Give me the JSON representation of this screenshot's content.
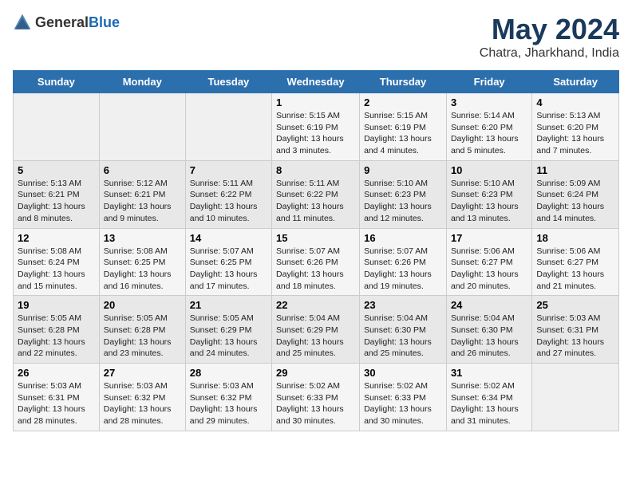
{
  "logo": {
    "text_general": "General",
    "text_blue": "Blue"
  },
  "header": {
    "main_title": "May 2024",
    "subtitle": "Chatra, Jharkhand, India"
  },
  "days_of_week": [
    "Sunday",
    "Monday",
    "Tuesday",
    "Wednesday",
    "Thursday",
    "Friday",
    "Saturday"
  ],
  "weeks": [
    {
      "days": [
        {
          "number": "",
          "info": ""
        },
        {
          "number": "",
          "info": ""
        },
        {
          "number": "",
          "info": ""
        },
        {
          "number": "1",
          "info": "Sunrise: 5:15 AM\nSunset: 6:19 PM\nDaylight: 13 hours and 3 minutes."
        },
        {
          "number": "2",
          "info": "Sunrise: 5:15 AM\nSunset: 6:19 PM\nDaylight: 13 hours and 4 minutes."
        },
        {
          "number": "3",
          "info": "Sunrise: 5:14 AM\nSunset: 6:20 PM\nDaylight: 13 hours and 5 minutes."
        },
        {
          "number": "4",
          "info": "Sunrise: 5:13 AM\nSunset: 6:20 PM\nDaylight: 13 hours and 7 minutes."
        }
      ]
    },
    {
      "days": [
        {
          "number": "5",
          "info": "Sunrise: 5:13 AM\nSunset: 6:21 PM\nDaylight: 13 hours and 8 minutes."
        },
        {
          "number": "6",
          "info": "Sunrise: 5:12 AM\nSunset: 6:21 PM\nDaylight: 13 hours and 9 minutes."
        },
        {
          "number": "7",
          "info": "Sunrise: 5:11 AM\nSunset: 6:22 PM\nDaylight: 13 hours and 10 minutes."
        },
        {
          "number": "8",
          "info": "Sunrise: 5:11 AM\nSunset: 6:22 PM\nDaylight: 13 hours and 11 minutes."
        },
        {
          "number": "9",
          "info": "Sunrise: 5:10 AM\nSunset: 6:23 PM\nDaylight: 13 hours and 12 minutes."
        },
        {
          "number": "10",
          "info": "Sunrise: 5:10 AM\nSunset: 6:23 PM\nDaylight: 13 hours and 13 minutes."
        },
        {
          "number": "11",
          "info": "Sunrise: 5:09 AM\nSunset: 6:24 PM\nDaylight: 13 hours and 14 minutes."
        }
      ]
    },
    {
      "days": [
        {
          "number": "12",
          "info": "Sunrise: 5:08 AM\nSunset: 6:24 PM\nDaylight: 13 hours and 15 minutes."
        },
        {
          "number": "13",
          "info": "Sunrise: 5:08 AM\nSunset: 6:25 PM\nDaylight: 13 hours and 16 minutes."
        },
        {
          "number": "14",
          "info": "Sunrise: 5:07 AM\nSunset: 6:25 PM\nDaylight: 13 hours and 17 minutes."
        },
        {
          "number": "15",
          "info": "Sunrise: 5:07 AM\nSunset: 6:26 PM\nDaylight: 13 hours and 18 minutes."
        },
        {
          "number": "16",
          "info": "Sunrise: 5:07 AM\nSunset: 6:26 PM\nDaylight: 13 hours and 19 minutes."
        },
        {
          "number": "17",
          "info": "Sunrise: 5:06 AM\nSunset: 6:27 PM\nDaylight: 13 hours and 20 minutes."
        },
        {
          "number": "18",
          "info": "Sunrise: 5:06 AM\nSunset: 6:27 PM\nDaylight: 13 hours and 21 minutes."
        }
      ]
    },
    {
      "days": [
        {
          "number": "19",
          "info": "Sunrise: 5:05 AM\nSunset: 6:28 PM\nDaylight: 13 hours and 22 minutes."
        },
        {
          "number": "20",
          "info": "Sunrise: 5:05 AM\nSunset: 6:28 PM\nDaylight: 13 hours and 23 minutes."
        },
        {
          "number": "21",
          "info": "Sunrise: 5:05 AM\nSunset: 6:29 PM\nDaylight: 13 hours and 24 minutes."
        },
        {
          "number": "22",
          "info": "Sunrise: 5:04 AM\nSunset: 6:29 PM\nDaylight: 13 hours and 25 minutes."
        },
        {
          "number": "23",
          "info": "Sunrise: 5:04 AM\nSunset: 6:30 PM\nDaylight: 13 hours and 25 minutes."
        },
        {
          "number": "24",
          "info": "Sunrise: 5:04 AM\nSunset: 6:30 PM\nDaylight: 13 hours and 26 minutes."
        },
        {
          "number": "25",
          "info": "Sunrise: 5:03 AM\nSunset: 6:31 PM\nDaylight: 13 hours and 27 minutes."
        }
      ]
    },
    {
      "days": [
        {
          "number": "26",
          "info": "Sunrise: 5:03 AM\nSunset: 6:31 PM\nDaylight: 13 hours and 28 minutes."
        },
        {
          "number": "27",
          "info": "Sunrise: 5:03 AM\nSunset: 6:32 PM\nDaylight: 13 hours and 28 minutes."
        },
        {
          "number": "28",
          "info": "Sunrise: 5:03 AM\nSunset: 6:32 PM\nDaylight: 13 hours and 29 minutes."
        },
        {
          "number": "29",
          "info": "Sunrise: 5:02 AM\nSunset: 6:33 PM\nDaylight: 13 hours and 30 minutes."
        },
        {
          "number": "30",
          "info": "Sunrise: 5:02 AM\nSunset: 6:33 PM\nDaylight: 13 hours and 30 minutes."
        },
        {
          "number": "31",
          "info": "Sunrise: 5:02 AM\nSunset: 6:34 PM\nDaylight: 13 hours and 31 minutes."
        },
        {
          "number": "",
          "info": ""
        }
      ]
    }
  ]
}
